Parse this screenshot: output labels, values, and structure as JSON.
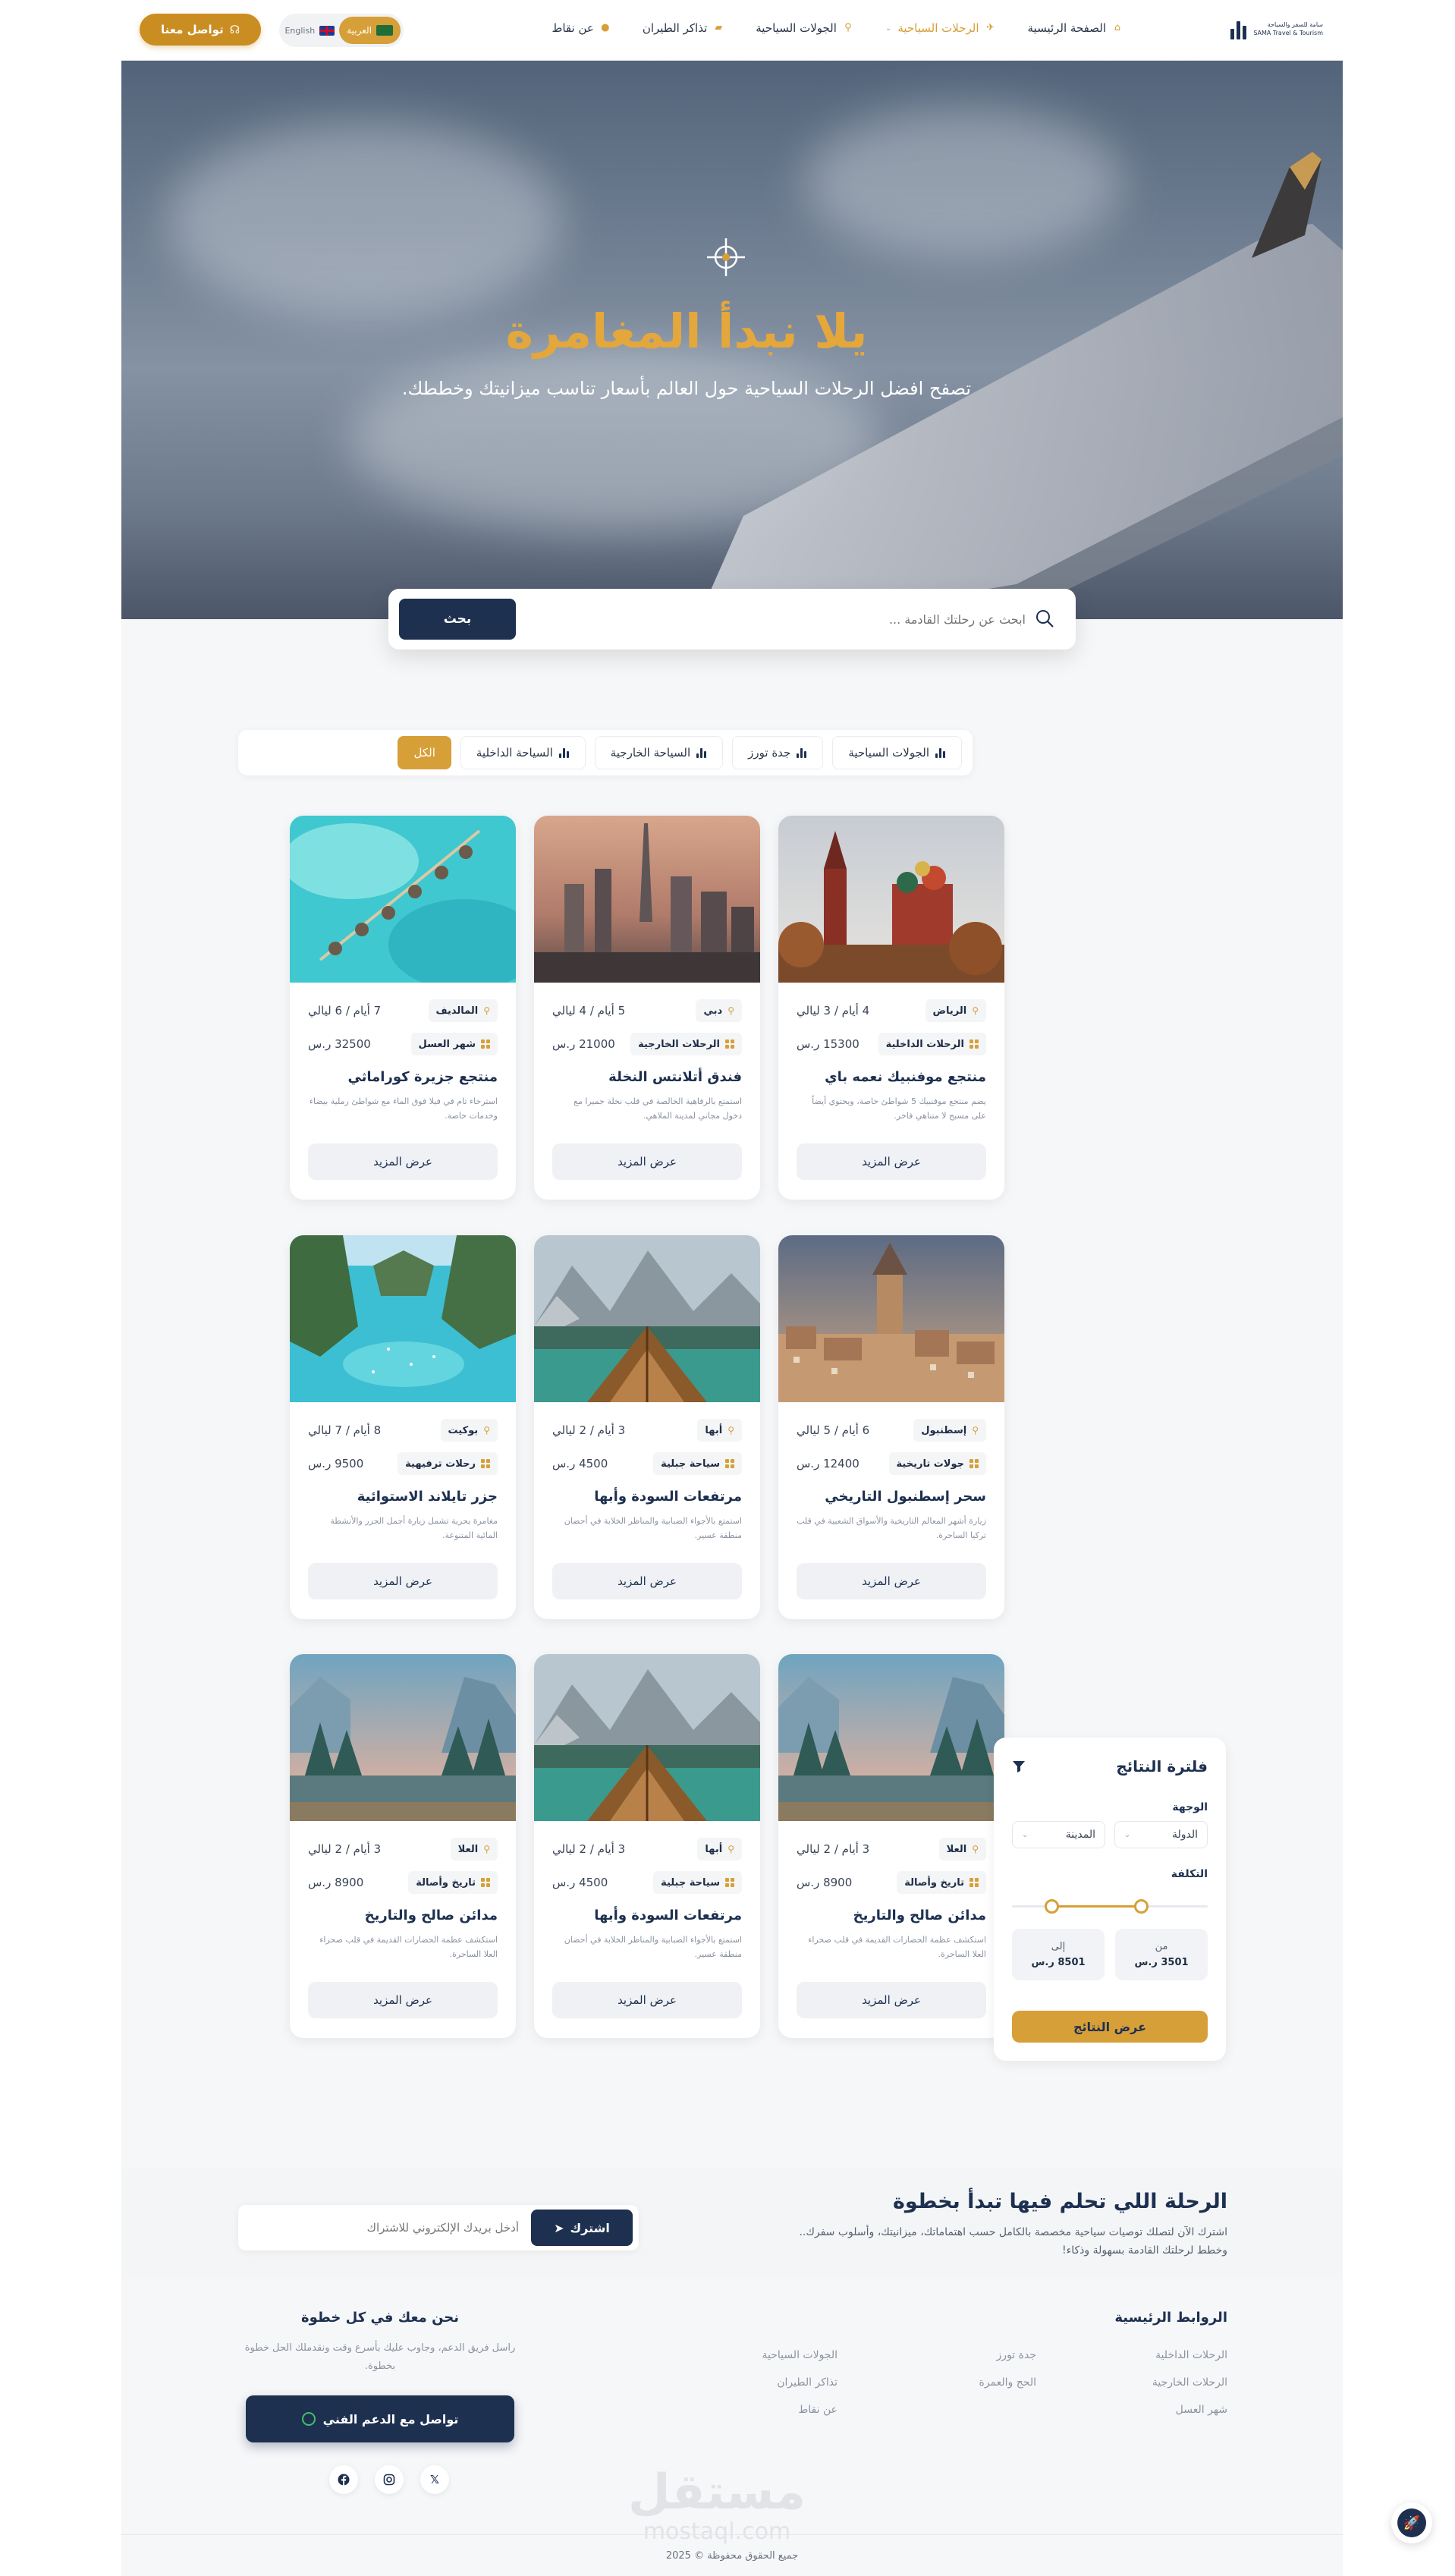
{
  "header": {
    "logo_text_ar": "سامة للسفر والسياحة",
    "logo_text_en": "SAMA Travel & Tourism",
    "nav": [
      {
        "label": "الصفحة الرئيسية",
        "icon": "home-icon"
      },
      {
        "label": "الرحلات السياحية",
        "icon": "plane-icon"
      },
      {
        "label": "الجولات السياحية",
        "icon": "map-pin-icon"
      },
      {
        "label": "تذاكر الطيران",
        "icon": "ticket-icon"
      },
      {
        "label": "عن نقاط",
        "icon": "coin-icon"
      }
    ],
    "lang_ar": "العربية",
    "lang_en": "English",
    "contact_label": "تواصل معنا"
  },
  "hero": {
    "title": "يلا نبدأ المغامرة",
    "subtitle": "تصفح افضل الرحلات السياحية حول العالم بأسعار تناسب ميزانيتك وخططك."
  },
  "search": {
    "placeholder": "ابحث عن رحلتك القادمة ...",
    "button": "بحث"
  },
  "tabs": [
    {
      "label": "الكل",
      "active": true
    },
    {
      "label": "السياحة الداخلية",
      "active": false
    },
    {
      "label": "السياحة الخارجية",
      "active": false
    },
    {
      "label": "جدة تورز",
      "active": false
    },
    {
      "label": "الجولات السياحية",
      "active": false
    }
  ],
  "cards": [
    {
      "location": "الرياض",
      "duration": "4 أيام / 3 ليالي",
      "category": "الرحلات الداخلية",
      "price": "15300 ر.س",
      "title": "منتجع موفنبيك نعمه باي",
      "desc": "يضم منتجع موفنبيك 5 شواطئ خاصة، ويحتوي أيضاً على مسبح لا متناهي فاخر.",
      "button": "عرض المزيد",
      "image": "moscow"
    },
    {
      "location": "دبي",
      "duration": "5 أيام / 4 ليالي",
      "category": "الرحلات الخارجية",
      "price": "21000 ر.س",
      "title": "فندق أتلانتس النخلة",
      "desc": "استمتع بالرفاهية الخالصة في قلب نخلة جميرا مع دخول مجاني لمدينة الملاهي.",
      "button": "عرض المزيد",
      "image": "dubai"
    },
    {
      "location": "المالديف",
      "duration": "7 أيام / 6 ليالي",
      "category": "شهر العسل",
      "price": "32500 ر.س",
      "title": "منتجع جزيرة كوراماثي",
      "desc": "استرخاء تام في فيلا فوق الماء مع شواطئ رملية بيضاء وخدمات خاصة.",
      "button": "عرض المزيد",
      "image": "maldives"
    },
    {
      "location": "إسطنبول",
      "duration": "6 أيام / 5 ليالي",
      "category": "جولات تاريخية",
      "price": "12400 ر.س",
      "title": "سحر إسطنبول التاريخي",
      "desc": "زيارة أشهر المعالم التاريخية والأسواق الشعبية في قلب تركيا الساحرة.",
      "button": "عرض المزيد",
      "image": "istanbul"
    },
    {
      "location": "أبها",
      "duration": "3 أيام / 2 ليالي",
      "category": "سياحة جبلية",
      "price": "4500 ر.س",
      "title": "مرتفعات السودة وأبها",
      "desc": "استمتع بالأجواء الضبابية والمناظر الخلابة في أحضان منطقة عسير.",
      "button": "عرض المزيد",
      "image": "lake"
    },
    {
      "location": "بوكيت",
      "duration": "8 أيام / 7 ليالي",
      "category": "رحلات ترفيهية",
      "price": "9500 ر.س",
      "title": "جزر تايلاند الاستوائية",
      "desc": "مغامرة بحرية تشمل زيارة أجمل الجزر والأنشطة المائية المتنوعة.",
      "button": "عرض المزيد",
      "image": "thailand"
    },
    {
      "location": "العلا",
      "duration": "3 أيام / 2 ليالي",
      "category": "تاريخ وأصالة",
      "price": "8900 ر.س",
      "title": "مدائن صالح والتاريخ",
      "desc": "استكشف عظمة الحضارات القديمة في قلب صحراء العلا الساحرة.",
      "button": "عرض المزيد",
      "image": "yosemite"
    },
    {
      "location": "أبها",
      "duration": "3 أيام / 2 ليالي",
      "category": "سياحة جبلية",
      "price": "4500 ر.س",
      "title": "مرتفعات السودة وأبها",
      "desc": "استمتع بالأجواء الضبابية والمناظر الخلابة في أحضان منطقة عسير.",
      "button": "عرض المزيد",
      "image": "lake"
    },
    {
      "location": "العلا",
      "duration": "3 أيام / 2 ليالي",
      "category": "تاريخ وأصالة",
      "price": "8900 ر.س",
      "title": "مدائن صالح والتاريخ",
      "desc": "استكشف عظمة الحضارات القديمة في قلب صحراء العلا الساحرة.",
      "button": "عرض المزيد",
      "image": "yosemite"
    }
  ],
  "filter": {
    "title": "فلترة النتائج",
    "destination_label": "الوجهة",
    "country": "الدولة",
    "city": "المدينة",
    "cost_label": "التكلفة",
    "range_min_fraction": 0.2,
    "range_max_fraction": 0.66,
    "from_label": "من",
    "from_value": "3501 ر.س",
    "to_label": "إلى",
    "to_value": "8501 ر.س",
    "button": "عرض النتائج"
  },
  "newsletter": {
    "title": "الرحلة اللي تحلم فيها تبدأ بخطوة",
    "text": "اشترك الآن لتصلك توصيات سياحية مخصصة بالكامل حسب اهتماماتك، ميزانيتك، وأسلوب سفرك.. وخطط لرحلتك القادمة بسهولة وذكاء!",
    "placeholder": "أدخل بريدك الإلكتروني للاشتراك",
    "button": "اشترك"
  },
  "footer": {
    "links_title": "الروابط الرئيسية",
    "col1": [
      "الرحلات الداخلية",
      "الرحلات الخارجية",
      "شهر العسل"
    ],
    "col2": [
      "جدة تورز",
      "الحج والعمرة"
    ],
    "col3": [
      "الجولات السياحية",
      "تذاكر الطيران",
      "عن نقاط"
    ],
    "support_title": "نحن معك في كل خطوة",
    "support_text": "راسل فريق الدعم، وجاوب عليك بأسرع وقت ونقدملك الحل خطوة بخطوة.",
    "support_button": "تواصل مع الدعم الفني",
    "socials": [
      "facebook-icon",
      "instagram-icon",
      "x-icon"
    ],
    "watermark_ar": "مستقل",
    "watermark_en": "mostaql.com",
    "copyright": "جميع الحقوق محفوظة © 2025"
  },
  "colors": {
    "accent": "#d79f38",
    "navy": "#1e3050",
    "background": "#f6f7f9"
  }
}
